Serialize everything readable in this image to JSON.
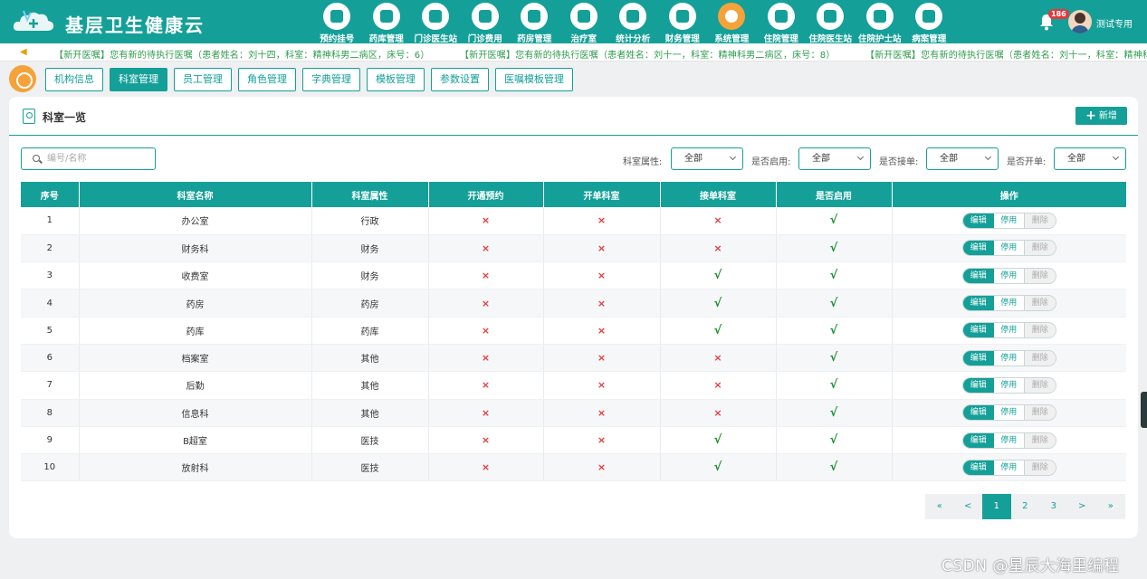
{
  "app": {
    "title": "基层卫生健康云"
  },
  "nav": [
    {
      "label": "预约挂号",
      "icon": "calendar-icon",
      "active": false
    },
    {
      "label": "药库管理",
      "icon": "warehouse-icon",
      "active": false
    },
    {
      "label": "门诊医生站",
      "icon": "doctor-icon",
      "active": false
    },
    {
      "label": "门诊费用",
      "icon": "yuan-icon",
      "active": false
    },
    {
      "label": "药房管理",
      "icon": "pill-icon",
      "active": false
    },
    {
      "label": "治疗室",
      "icon": "treatment-icon",
      "active": false
    },
    {
      "label": "统计分析",
      "icon": "chart-icon",
      "active": false
    },
    {
      "label": "财务管理",
      "icon": "finance-gear-icon",
      "active": false
    },
    {
      "label": "系统管理",
      "icon": "settings-icon",
      "active": true
    },
    {
      "label": "住院管理",
      "icon": "bed-icon",
      "active": false
    },
    {
      "label": "住院医生站",
      "icon": "inpatient-doctor-icon",
      "active": false
    },
    {
      "label": "住院护士站",
      "icon": "nurse-icon",
      "active": false
    },
    {
      "label": "病案管理",
      "icon": "record-icon",
      "active": false
    }
  ],
  "user": {
    "badge": "186",
    "name": "测试专用"
  },
  "marquee": [
    "【新开医嘱】您有新的待执行医嘱（患者姓名：刘十四，科室：精神科男二病区，床号：6）",
    "【新开医嘱】您有新的待执行医嘱（患者姓名：刘十一，科室：精神科男二病区，床号：8）",
    "【新开医嘱】您有新的待执行医嘱（患者姓名：刘十一，科室：精神科男二病区，"
  ],
  "tabs": [
    {
      "label": "机构信息",
      "active": false
    },
    {
      "label": "科室管理",
      "active": true
    },
    {
      "label": "员工管理",
      "active": false
    },
    {
      "label": "角色管理",
      "active": false
    },
    {
      "label": "字典管理",
      "active": false
    },
    {
      "label": "模板管理",
      "active": false
    },
    {
      "label": "参数设置",
      "active": false
    },
    {
      "label": "医嘱模板管理",
      "active": false
    }
  ],
  "panel": {
    "title": "科室一览",
    "add_label": "新增"
  },
  "search": {
    "placeholder": "编号/名称",
    "value": ""
  },
  "filters": [
    {
      "label": "科室属性:",
      "value": "全部"
    },
    {
      "label": "是否启用:",
      "value": "全部"
    },
    {
      "label": "是否接单:",
      "value": "全部"
    },
    {
      "label": "是否开单:",
      "value": "全部"
    }
  ],
  "table": {
    "columns": [
      "序号",
      "科室名称",
      "科室属性",
      "开通预约",
      "开单科室",
      "接单科室",
      "是否启用",
      "操作"
    ],
    "actions": {
      "edit": "编辑",
      "disable": "停用",
      "delete": "删除"
    },
    "yes_mark": "√",
    "no_mark": "×",
    "rows": [
      {
        "no": "1",
        "name": "办公室",
        "attr": "行政",
        "booking": false,
        "order_dept": false,
        "accept_dept": false,
        "enabled": true
      },
      {
        "no": "2",
        "name": "财务科",
        "attr": "财务",
        "booking": false,
        "order_dept": false,
        "accept_dept": false,
        "enabled": true
      },
      {
        "no": "3",
        "name": "收费室",
        "attr": "财务",
        "booking": false,
        "order_dept": false,
        "accept_dept": true,
        "enabled": true
      },
      {
        "no": "4",
        "name": "药房",
        "attr": "药房",
        "booking": false,
        "order_dept": false,
        "accept_dept": true,
        "enabled": true
      },
      {
        "no": "5",
        "name": "药库",
        "attr": "药库",
        "booking": false,
        "order_dept": false,
        "accept_dept": true,
        "enabled": true
      },
      {
        "no": "6",
        "name": "档案室",
        "attr": "其他",
        "booking": false,
        "order_dept": false,
        "accept_dept": false,
        "enabled": true
      },
      {
        "no": "7",
        "name": "后勤",
        "attr": "其他",
        "booking": false,
        "order_dept": false,
        "accept_dept": false,
        "enabled": true
      },
      {
        "no": "8",
        "name": "信息科",
        "attr": "其他",
        "booking": false,
        "order_dept": false,
        "accept_dept": false,
        "enabled": true
      },
      {
        "no": "9",
        "name": "B超室",
        "attr": "医技",
        "booking": false,
        "order_dept": false,
        "accept_dept": true,
        "enabled": true
      },
      {
        "no": "10",
        "name": "放射科",
        "attr": "医技",
        "booking": false,
        "order_dept": false,
        "accept_dept": true,
        "enabled": true
      }
    ]
  },
  "pagination": {
    "first": "«",
    "prev": "<",
    "pages": [
      "1",
      "2",
      "3"
    ],
    "current": "1",
    "next": ">",
    "last": "»"
  },
  "watermark": "CSDN @星辰大海里编程",
  "colors": {
    "primary": "#14a098",
    "accent": "#f5a23a",
    "no": "#e4393c",
    "yes": "#1a8f2c"
  }
}
